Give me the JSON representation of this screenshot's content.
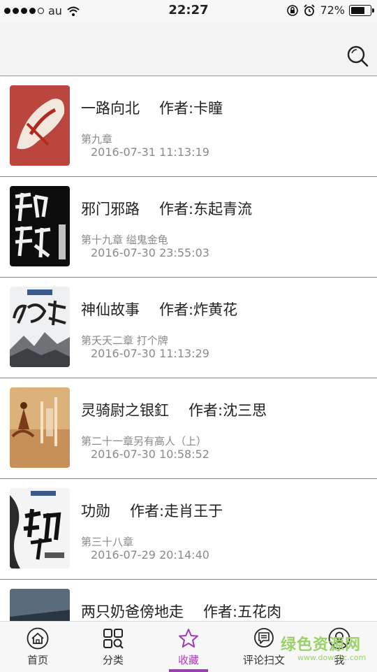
{
  "status_bar": {
    "carrier": "au",
    "time": "22:27",
    "battery_percent": "72%",
    "battery_level": 0.72
  },
  "header": {
    "search_icon": "search-icon"
  },
  "books": [
    {
      "title": "一路向北",
      "author": "作者:卡瞳",
      "chapter": "第九章",
      "updated": "2016-07-31 11:13:19"
    },
    {
      "title": "邪门邪路",
      "author": "作者:东起青流",
      "chapter": "第十九章 缢鬼金龟",
      "updated": "2016-07-30 23:55:03"
    },
    {
      "title": "神仙故事",
      "author": "作者:炸黄花",
      "chapter": "第夭夭二章 打个牌",
      "updated": "2016-07-30 11:13:29"
    },
    {
      "title": "灵骑尉之银釭",
      "author": "作者:沈三思",
      "chapter": "第二十一章另有高人（上）",
      "updated": "2016-07-30 10:58:52"
    },
    {
      "title": "功勋",
      "author": "作者:走肖王于",
      "chapter": "第三十八章",
      "updated": "2016-07-29 20:14:40"
    },
    {
      "title": "两只奶爸傍地走",
      "author": "作者:五花肉",
      "chapter": "",
      "updated": ""
    }
  ],
  "tabs": [
    {
      "label": "首页",
      "icon": "home-icon"
    },
    {
      "label": "分类",
      "icon": "category-icon"
    },
    {
      "label": "收藏",
      "icon": "star-icon",
      "active": true
    },
    {
      "label": "评论扫文",
      "icon": "comment-icon"
    },
    {
      "label": "我",
      "icon": "user-icon"
    }
  ],
  "watermark": {
    "title": "绿色资源网",
    "url": "www.downcc.com"
  },
  "colors": {
    "accent": "#a13bb5",
    "divider": "#8a8a8a",
    "meta_text": "#8a8a8a"
  }
}
